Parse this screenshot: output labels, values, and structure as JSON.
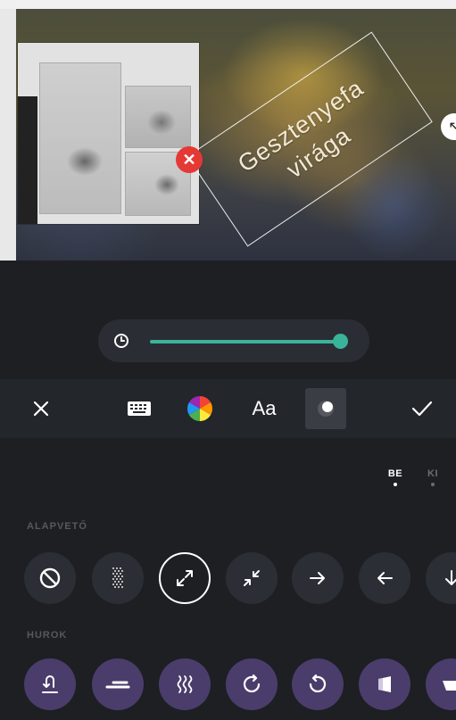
{
  "sticker": {
    "line1": "Gesztenyefa",
    "line2": "virága"
  },
  "toolbar": {
    "font_label": "Aa"
  },
  "toggle": {
    "on_label": "BE",
    "off_label": "KI",
    "selected": "BE"
  },
  "sections": {
    "basic_label": "ALAPVETŐ",
    "loop_label": "HUROK"
  },
  "animation_duration": {
    "fraction": 1.0
  },
  "icons": {
    "basic": [
      "none-icon",
      "fade-icon",
      "expand-icon",
      "shrink-icon",
      "arrow-right-icon",
      "arrow-left-icon",
      "arrow-down-icon"
    ],
    "loop": [
      "anchor-bounce-icon",
      "slide-icon",
      "wave-icon",
      "rotate-cw-icon",
      "rotate-ccw-icon",
      "flag-icon",
      "partial-icon"
    ]
  },
  "colors": {
    "accent": "#3ab39a",
    "loop_bg": "#4a3d6b",
    "delete": "#e53935",
    "panel_bg": "#1d1f23"
  }
}
